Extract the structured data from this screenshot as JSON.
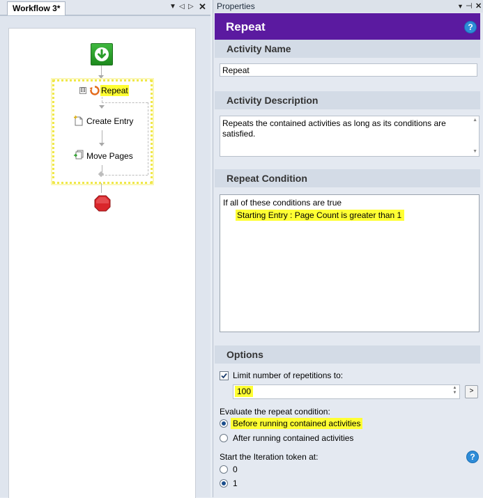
{
  "document": {
    "tab_label": "Workflow 3*"
  },
  "workflow": {
    "activities": {
      "repeat_label": "Repeat",
      "create_entry_label": "Create Entry",
      "move_pages_label": "Move Pages"
    },
    "collapse_glyph": "⊟"
  },
  "properties": {
    "pane_title": "Properties",
    "header_title": "Repeat",
    "sections": {
      "activity_name": "Activity Name",
      "activity_description": "Activity Description",
      "repeat_condition": "Repeat Condition",
      "options": "Options"
    },
    "activity_name_value": "Repeat",
    "activity_description_value": "Repeats the contained activities as long as its conditions are satisfied.",
    "condition": {
      "intro": "If all of these conditions are true",
      "rule": "Starting Entry : Page Count is greater than 1"
    },
    "options": {
      "limit_checked": true,
      "limit_label": "Limit number of repetitions to:",
      "limit_value": "100",
      "limit_button": ">",
      "evaluate_label": "Evaluate the repeat condition:",
      "evaluate_options": [
        {
          "label": "Before running contained activities",
          "selected": true
        },
        {
          "label": "After running contained activities",
          "selected": false
        }
      ],
      "iteration_label": "Start the Iteration token at:",
      "iteration_options": [
        {
          "label": "0",
          "selected": false
        },
        {
          "label": "1",
          "selected": true
        }
      ]
    }
  },
  "colors": {
    "header_bg": "#5b1aa0",
    "highlight": "#ffff33",
    "start_node": "#2a9d2a",
    "stop_node": "#d9262b",
    "help_icon": "#2e8cd8"
  },
  "icons": [
    "pin-icon",
    "close-icon",
    "dropdown-icon",
    "scroll-left-icon",
    "scroll-right-icon",
    "help-icon",
    "start-node-icon",
    "repeat-icon",
    "create-entry-icon",
    "move-pages-icon",
    "stop-node-icon"
  ]
}
